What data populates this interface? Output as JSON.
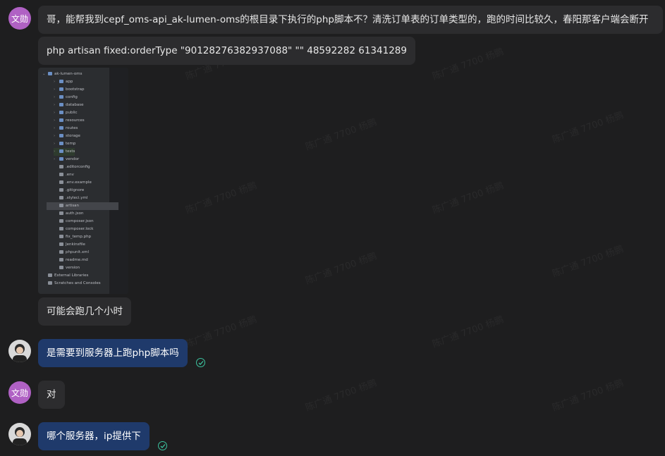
{
  "messages": [
    {
      "sender": "文勋",
      "text": "哥，能帮我到cepf_oms-api_ak-lumen-oms的根目录下执行的php脚本不？清洗订单表的订单类型的，跑的时间比较久，春阳那客户端会断开"
    },
    {
      "text": "php artisan fixed:orderType \"90128276382937088\" \"\" 48592282 61341289"
    },
    {
      "text": "可能会跑几个小时"
    },
    {
      "sender": "me",
      "text": "是需要到服务器上跑php脚本吗"
    },
    {
      "sender": "文勋",
      "text": "对"
    },
    {
      "sender": "me",
      "text": "哪个服务器，ip提供下"
    }
  ],
  "screenshot_tree": {
    "root": "ak-lumen-oms",
    "items": [
      "app",
      "bootstrap",
      "config",
      "database",
      "public",
      "resources",
      "routes",
      "storage",
      "temp",
      "tests",
      "vendor",
      ".editorconfig",
      ".env",
      ".env.example",
      ".gitignore",
      ".styleci.yml",
      "artisan",
      "auth.json",
      "composer.json",
      "composer.lock",
      "fix_temp.php",
      "Jenkinsfile",
      "phpunit.xml",
      "readme.md",
      "version",
      "External Libraries",
      "Scratches and Consoles"
    ]
  },
  "watermark": "陈广通 7700 杨鹏",
  "colors": {
    "bg": "#1e1e1f",
    "bubble": "#2c2c2e",
    "mine": "#1f3a6b",
    "avatar": "#b061c4",
    "check": "#3cc4a0"
  }
}
